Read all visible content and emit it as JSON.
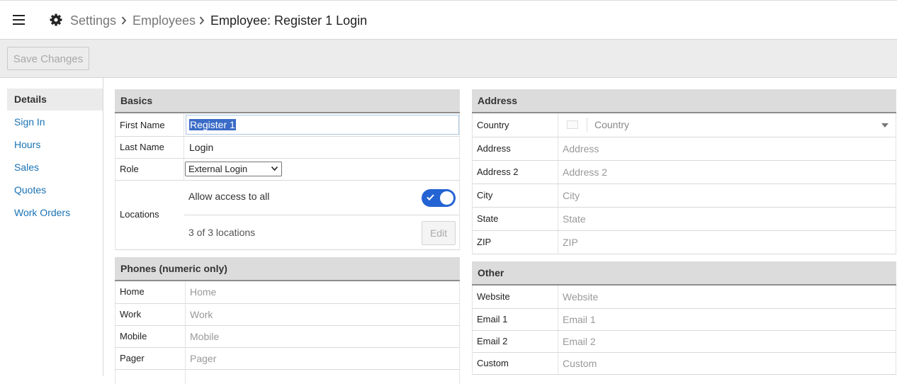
{
  "breadcrumb": {
    "settings": "Settings",
    "employees": "Employees",
    "current": "Employee: Register 1 Login"
  },
  "toolbar": {
    "save_label": "Save Changes"
  },
  "sidenav": {
    "items": [
      "Details",
      "Sign In",
      "Hours",
      "Sales",
      "Quotes",
      "Work Orders"
    ],
    "active_index": 0
  },
  "basics": {
    "title": "Basics",
    "first_name_label": "First Name",
    "first_name_value": "Register 1",
    "last_name_label": "Last Name",
    "last_name_value": "Login",
    "role_label": "Role",
    "role_value": "External Login",
    "locations_label": "Locations",
    "allow_access_label": "Allow access to all",
    "allow_access_on": true,
    "locations_count": "3 of 3 locations",
    "edit_label": "Edit"
  },
  "phones": {
    "title": "Phones (numeric only)",
    "rows": [
      {
        "label": "Home",
        "placeholder": "Home"
      },
      {
        "label": "Work",
        "placeholder": "Work"
      },
      {
        "label": "Mobile",
        "placeholder": "Mobile"
      },
      {
        "label": "Pager",
        "placeholder": "Pager"
      }
    ]
  },
  "address": {
    "title": "Address",
    "country_label": "Country",
    "country_placeholder": "Country",
    "rows": [
      {
        "label": "Address",
        "placeholder": "Address"
      },
      {
        "label": "Address 2",
        "placeholder": "Address 2"
      },
      {
        "label": "City",
        "placeholder": "City"
      },
      {
        "label": "State",
        "placeholder": "State"
      },
      {
        "label": "ZIP",
        "placeholder": "ZIP"
      }
    ]
  },
  "other": {
    "title": "Other",
    "rows": [
      {
        "label": "Website",
        "placeholder": "Website"
      },
      {
        "label": "Email 1",
        "placeholder": "Email 1"
      },
      {
        "label": "Email 2",
        "placeholder": "Email 2"
      },
      {
        "label": "Custom",
        "placeholder": "Custom"
      }
    ]
  },
  "colors": {
    "accent": "#2463d3",
    "link": "#1a73b5",
    "header_bg": "#dcdcdc"
  }
}
